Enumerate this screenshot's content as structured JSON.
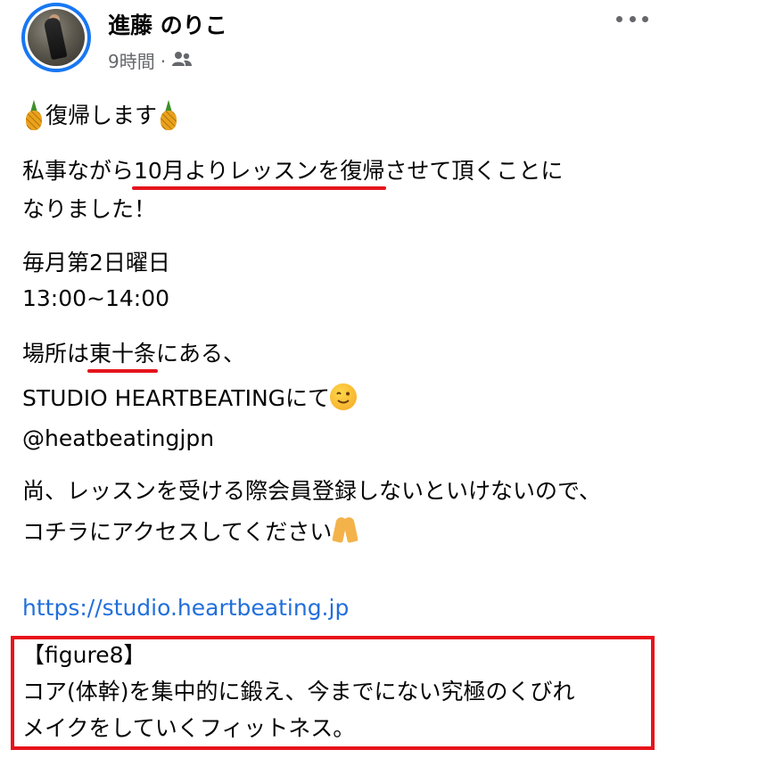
{
  "post": {
    "author": "進藤 のりこ",
    "time": "9時間",
    "separator": "·",
    "audience_icon": "friends-icon",
    "more_icon": "more-options-icon"
  },
  "content": {
    "headline": "復帰します",
    "p1_before": "私事ながら",
    "p1_underlined": "10月よりレッスンを復帰",
    "p1_after": "させて頂くことに",
    "p1_line2": "なりました！",
    "schedule_day": "毎月第2日曜日",
    "schedule_time": "13:00~14:00",
    "place_before": "場所は",
    "place_underlined": "東十条",
    "place_after": "にある、",
    "studio": "STUDIO HEARTBEATINGにて",
    "handle": "@heatbeatingjpn",
    "note1": "尚、レッスンを受ける際会員登録しないといけないので、",
    "note2": "コチラにアクセスしてください",
    "link": "https://studio.heartbeating.jp",
    "figure_title": "【figure8】",
    "figure_desc1": "コア(体幹)を集中的に鍛え、今までにない究極のくびれ",
    "figure_desc2": "メイクをしていくフィットネス。"
  },
  "colors": {
    "link": "#216fdb",
    "annotation_red": "#e8121a",
    "avatar_ring": "#1877f2",
    "meta_gray": "#65676b"
  }
}
